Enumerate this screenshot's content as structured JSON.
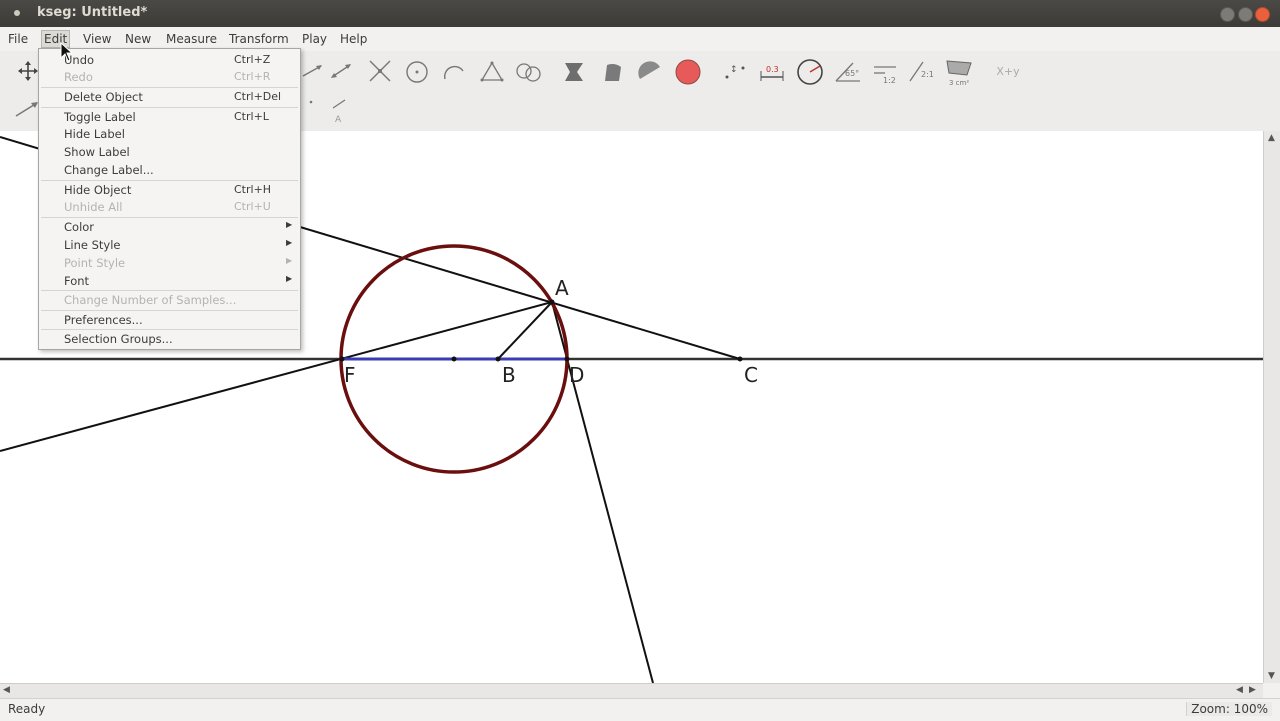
{
  "window": {
    "title": "kseg: Untitled*"
  },
  "menubar": {
    "items": [
      "File",
      "Edit",
      "View",
      "New",
      "Measure",
      "Transform",
      "Play",
      "Help"
    ]
  },
  "edit_menu": {
    "items": [
      {
        "label": "Undo",
        "shortcut": "Ctrl+Z",
        "enabled": true
      },
      {
        "label": "Redo",
        "shortcut": "Ctrl+R",
        "enabled": false
      },
      {
        "label": "Delete Object",
        "shortcut": "Ctrl+Del",
        "enabled": true
      },
      {
        "label": "Toggle Label",
        "shortcut": "Ctrl+L",
        "enabled": true
      },
      {
        "label": "Hide Label",
        "shortcut": "",
        "enabled": true
      },
      {
        "label": "Show Label",
        "shortcut": "",
        "enabled": true
      },
      {
        "label": "Change Label...",
        "shortcut": "",
        "enabled": true
      },
      {
        "label": "Hide Object",
        "shortcut": "Ctrl+H",
        "enabled": true
      },
      {
        "label": "Unhide All",
        "shortcut": "Ctrl+U",
        "enabled": false
      },
      {
        "label": "Color",
        "shortcut": "",
        "enabled": true,
        "submenu": true
      },
      {
        "label": "Line Style",
        "shortcut": "",
        "enabled": true,
        "submenu": true
      },
      {
        "label": "Point Style",
        "shortcut": "",
        "enabled": false,
        "submenu": true
      },
      {
        "label": "Font",
        "shortcut": "",
        "enabled": true,
        "submenu": true
      },
      {
        "label": "Change Number of Samples...",
        "shortcut": "",
        "enabled": false
      },
      {
        "label": "Preferences...",
        "shortcut": "",
        "enabled": true
      },
      {
        "label": "Selection Groups...",
        "shortcut": "",
        "enabled": true
      }
    ]
  },
  "toolbar": {
    "icons": [
      "move-icon",
      "construct-arrow-icon",
      "segment-icon",
      "ray-icon",
      "line-icon",
      "intersection-icon",
      "circle-icon",
      "arc-icon",
      "triangle-icon",
      "circle-by-points-icon",
      "polygon-icon",
      "sector-icon",
      "arc-segment-icon",
      "filled-circle-icon",
      "measure-distance-icon",
      "measure-length-icon",
      "measure-radius-icon",
      "measure-angle-icon",
      "measure-ratio-icon",
      "measure-slope-icon",
      "measure-area-icon",
      "calculate-icon"
    ],
    "labels": {
      "angle": "65°",
      "ratio": "1:2",
      "slope": "2:1",
      "area": "3 cm²",
      "calc": "X+y"
    }
  },
  "canvas": {
    "points": [
      {
        "label": "A"
      },
      {
        "label": "B"
      },
      {
        "label": "C"
      },
      {
        "label": "D"
      },
      {
        "label": "F"
      }
    ],
    "circle_color": "#6b0e0e",
    "segment_color": "#3b3bb5"
  },
  "statusbar": {
    "status": "Ready",
    "zoom": "Zoom: 100%"
  }
}
